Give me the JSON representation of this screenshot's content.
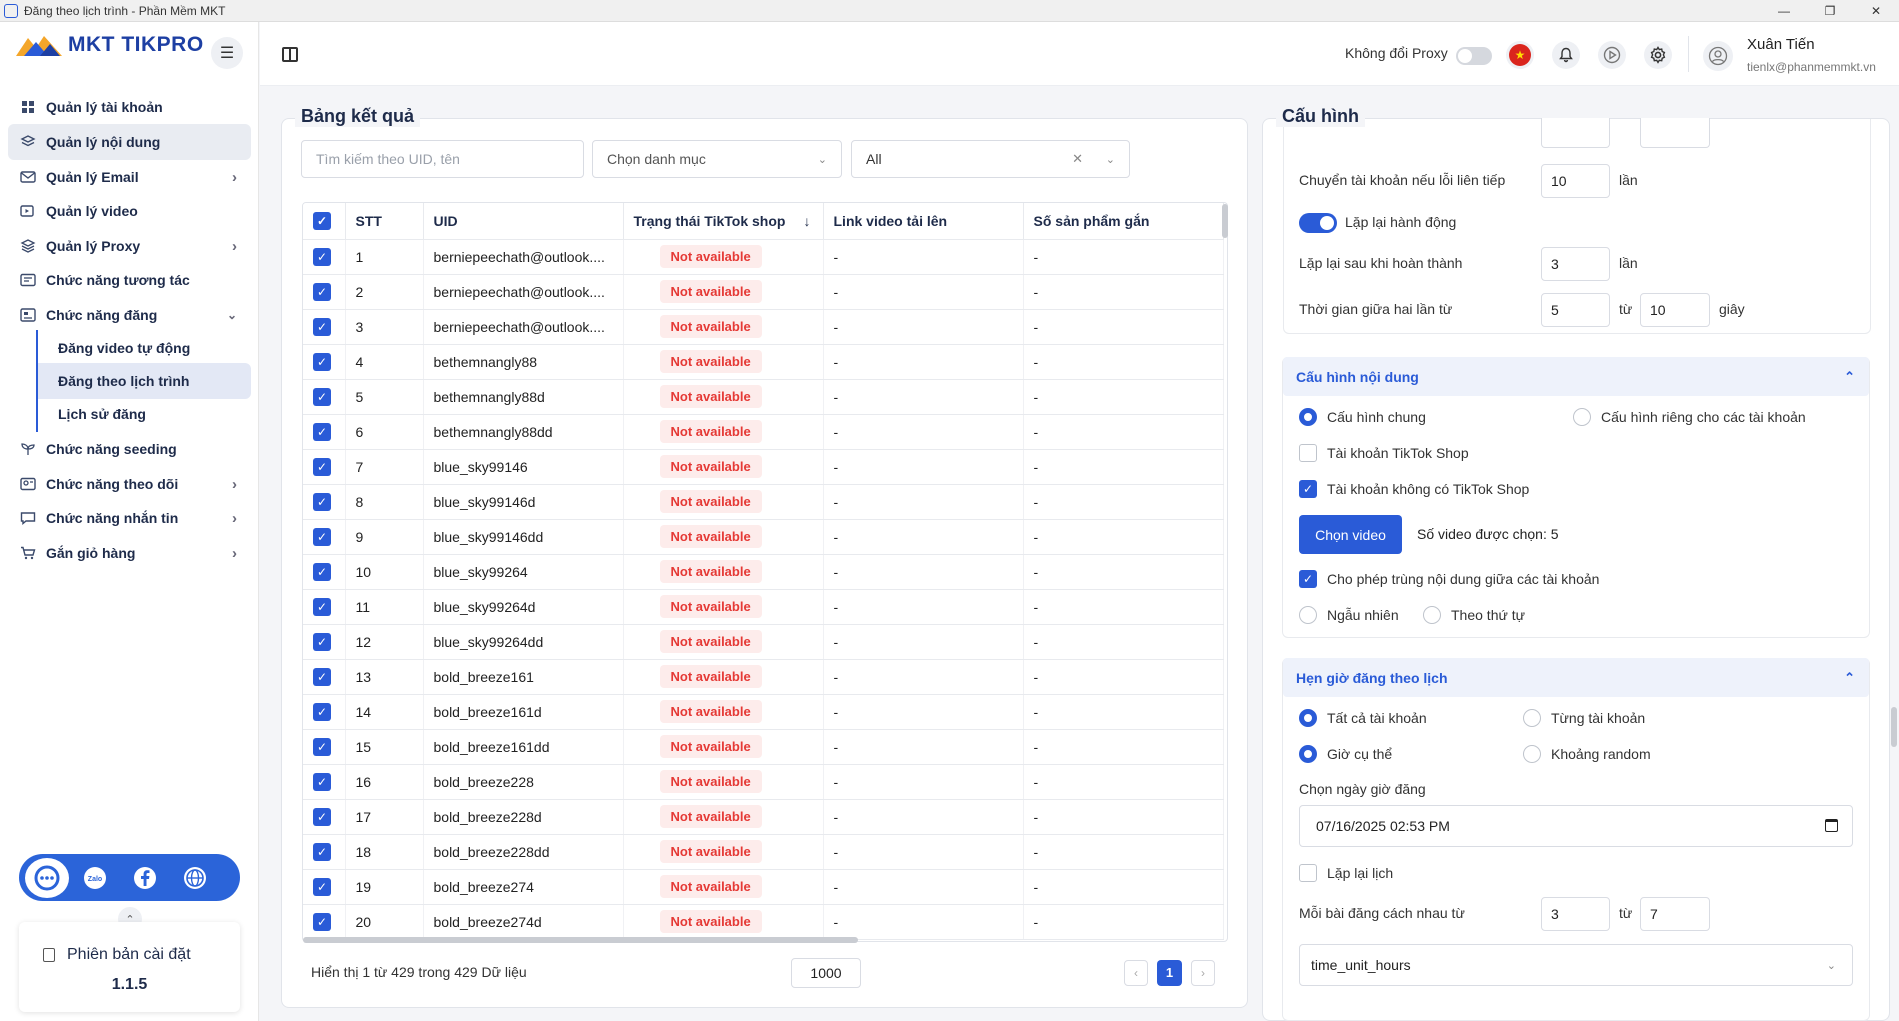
{
  "window": {
    "title": "Đăng theo lịch trình - Phần Mềm MKT"
  },
  "brand": {
    "name": "MKT TIKPRO"
  },
  "sidebar": {
    "items": [
      {
        "label": "Quản lý tài khoản",
        "icon": "grid-icon"
      },
      {
        "label": "Quản lý nội dung",
        "icon": "layers-icon",
        "active": true
      },
      {
        "label": "Quản lý Email",
        "icon": "mail-icon",
        "chevron": true
      },
      {
        "label": "Quản lý video",
        "icon": "video-icon"
      },
      {
        "label": "Quản lý Proxy",
        "icon": "stack-icon",
        "chevron": true
      },
      {
        "label": "Chức năng tương tác",
        "icon": "chat-icon"
      },
      {
        "label": "Chức năng đăng",
        "icon": "post-icon",
        "expanded": true
      }
    ],
    "sub_items": [
      {
        "label": "Đăng video tự động"
      },
      {
        "label": "Đăng theo lịch trình",
        "active": true
      },
      {
        "label": "Lịch sử đăng"
      }
    ],
    "items_after": [
      {
        "label": "Chức năng seeding",
        "icon": "seed-icon"
      },
      {
        "label": "Chức năng theo dõi",
        "icon": "follow-icon",
        "chevron": true
      },
      {
        "label": "Chức năng nhắn tin",
        "icon": "message-icon",
        "chevron": true
      },
      {
        "label": "Gắn giỏ hàng",
        "icon": "cart-icon",
        "chevron": true
      }
    ],
    "social": {
      "zalo_label": "Zalo"
    },
    "version": {
      "label": "Phiên bản cài đặt",
      "number": "1.1.5"
    }
  },
  "header": {
    "proxy_label": "Không đổi Proxy",
    "user_name": "Xuân Tiến",
    "user_email": "tienlx@phanmemmkt.vn"
  },
  "results": {
    "title": "Bảng kết quả",
    "search_placeholder": "Tìm kiếm theo UID, tên",
    "category_placeholder": "Chọn danh mục",
    "filter_value": "All",
    "columns": [
      "STT",
      "UID",
      "Trạng thái TikTok shop",
      "Link video tải lên",
      "Số sản phẩm gắn"
    ],
    "rows": [
      {
        "stt": "1",
        "uid": "berniepeechath@outlook....",
        "status": "Not available",
        "link": "-",
        "count": "-"
      },
      {
        "stt": "2",
        "uid": "berniepeechath@outlook....",
        "status": "Not available",
        "link": "-",
        "count": "-"
      },
      {
        "stt": "3",
        "uid": "berniepeechath@outlook....",
        "status": "Not available",
        "link": "-",
        "count": "-"
      },
      {
        "stt": "4",
        "uid": "bethemnangly88",
        "status": "Not available",
        "link": "-",
        "count": "-"
      },
      {
        "stt": "5",
        "uid": "bethemnangly88d",
        "status": "Not available",
        "link": "-",
        "count": "-"
      },
      {
        "stt": "6",
        "uid": "bethemnangly88dd",
        "status": "Not available",
        "link": "-",
        "count": "-"
      },
      {
        "stt": "7",
        "uid": "blue_sky99146",
        "status": "Not available",
        "link": "-",
        "count": "-"
      },
      {
        "stt": "8",
        "uid": "blue_sky99146d",
        "status": "Not available",
        "link": "-",
        "count": "-"
      },
      {
        "stt": "9",
        "uid": "blue_sky99146dd",
        "status": "Not available",
        "link": "-",
        "count": "-"
      },
      {
        "stt": "10",
        "uid": "blue_sky99264",
        "status": "Not available",
        "link": "-",
        "count": "-"
      },
      {
        "stt": "11",
        "uid": "blue_sky99264d",
        "status": "Not available",
        "link": "-",
        "count": "-"
      },
      {
        "stt": "12",
        "uid": "blue_sky99264dd",
        "status": "Not available",
        "link": "-",
        "count": "-"
      },
      {
        "stt": "13",
        "uid": "bold_breeze161",
        "status": "Not available",
        "link": "-",
        "count": "-"
      },
      {
        "stt": "14",
        "uid": "bold_breeze161d",
        "status": "Not available",
        "link": "-",
        "count": "-"
      },
      {
        "stt": "15",
        "uid": "bold_breeze161dd",
        "status": "Not available",
        "link": "-",
        "count": "-"
      },
      {
        "stt": "16",
        "uid": "bold_breeze228",
        "status": "Not available",
        "link": "-",
        "count": "-"
      },
      {
        "stt": "17",
        "uid": "bold_breeze228d",
        "status": "Not available",
        "link": "-",
        "count": "-"
      },
      {
        "stt": "18",
        "uid": "bold_breeze228dd",
        "status": "Not available",
        "link": "-",
        "count": "-"
      },
      {
        "stt": "19",
        "uid": "bold_breeze274",
        "status": "Not available",
        "link": "-",
        "count": "-"
      },
      {
        "stt": "20",
        "uid": "bold_breeze274d",
        "status": "Not available",
        "link": "-",
        "count": "-"
      }
    ],
    "footer_text": "Hiển thị 1 từ 429 trong 429 Dữ liệu",
    "page_size": "1000",
    "current_page": "1"
  },
  "config": {
    "title": "Cấu hình",
    "switch_account_label": "Chuyển tài khoản nếu lỗi liên tiếp",
    "switch_account_value": "10",
    "unit_times": "lần",
    "repeat_action_label": "Lặp lại hành động",
    "repeat_after_label": "Lặp lại sau khi hoàn thành",
    "repeat_after_value": "3",
    "interval_label": "Thời gian giữa hai lần từ",
    "interval_from": "5",
    "word_to": "từ",
    "interval_to": "10",
    "unit_seconds": "giây",
    "content_section": {
      "title": "Cấu hình nội dung",
      "general_label": "Cấu hình chung",
      "per_account_label": "Cấu hình riêng cho các tài khoản",
      "shop_account_label": "Tài khoản TikTok Shop",
      "no_shop_account_label": "Tài khoản không có TikTok Shop",
      "choose_video_label": "Chọn video",
      "selected_videos_text": "Số video được chọn: 5",
      "allow_duplicate_label": "Cho phép trùng nội dung giữa các tài khoản",
      "random_label": "Ngẫu nhiên",
      "ordered_label": "Theo thứ tự"
    },
    "schedule_section": {
      "title": "Hẹn giờ đăng theo lịch",
      "all_accounts_label": "Tất cả tài khoản",
      "each_account_label": "Từng tài khoản",
      "specific_time_label": "Giờ cụ thể",
      "random_range_label": "Khoảng random",
      "pick_datetime_label": "Chọn ngày giờ đăng",
      "datetime_value": "07/16/2025 02:53 PM",
      "repeat_schedule_label": "Lặp lại lịch",
      "spacing_label": "Mỗi bài đăng cách nhau từ",
      "spacing_from": "3",
      "spacing_to": "7",
      "unit_select_value": "time_unit_hours"
    }
  },
  "colors": {
    "accent": "#2a5bd7",
    "badge_text": "#e53935",
    "badge_bg": "#fdeceb"
  }
}
